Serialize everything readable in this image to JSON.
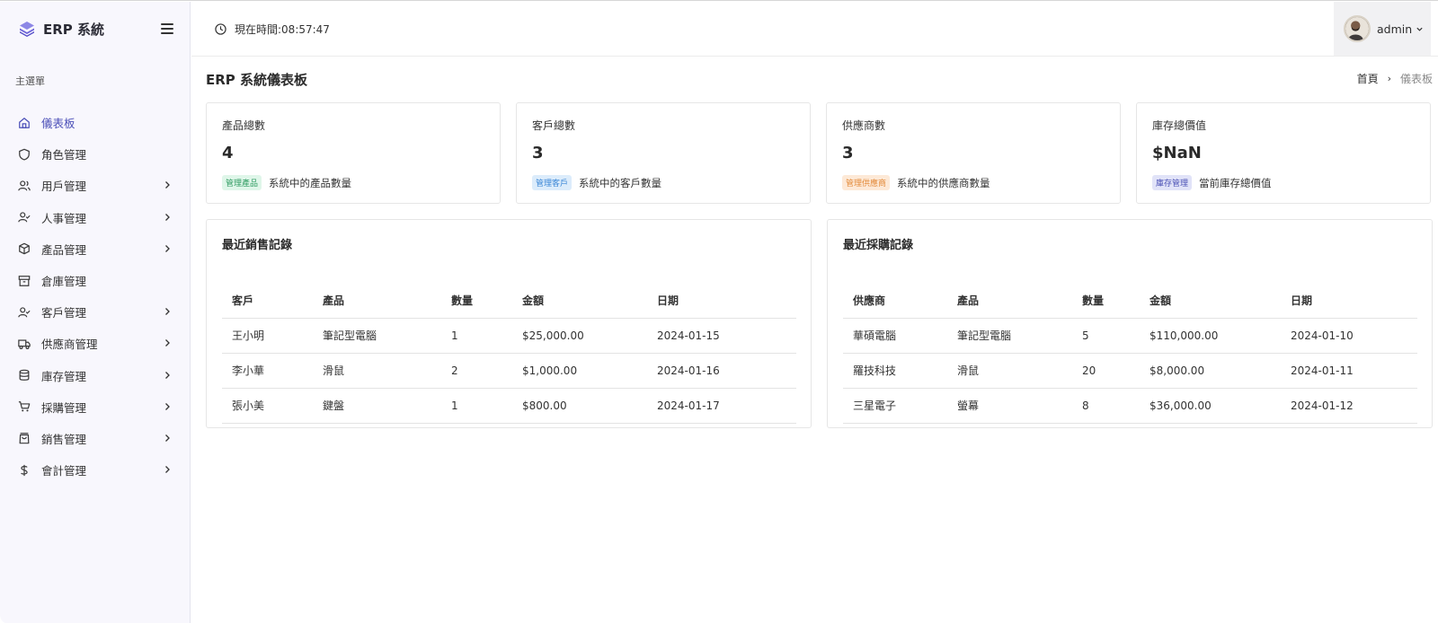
{
  "app": {
    "title": "ERP 系統"
  },
  "sidebar": {
    "section_label": "主選單",
    "items": [
      {
        "label": "儀表板",
        "icon": "home-icon",
        "active": true,
        "has_children": false
      },
      {
        "label": "角色管理",
        "icon": "shield-icon",
        "active": false,
        "has_children": false
      },
      {
        "label": "用戶管理",
        "icon": "users-icon",
        "active": false,
        "has_children": true
      },
      {
        "label": "人事管理",
        "icon": "user-check-icon",
        "active": false,
        "has_children": true
      },
      {
        "label": "產品管理",
        "icon": "package-icon",
        "active": false,
        "has_children": true
      },
      {
        "label": "倉庫管理",
        "icon": "archive-icon",
        "active": false,
        "has_children": false
      },
      {
        "label": "客戶管理",
        "icon": "user-check-icon",
        "active": false,
        "has_children": true
      },
      {
        "label": "供應商管理",
        "icon": "truck-icon",
        "active": false,
        "has_children": true
      },
      {
        "label": "庫存管理",
        "icon": "database-icon",
        "active": false,
        "has_children": true
      },
      {
        "label": "採購管理",
        "icon": "cart-icon",
        "active": false,
        "has_children": true
      },
      {
        "label": "銷售管理",
        "icon": "shopping-bag-icon",
        "active": false,
        "has_children": true
      },
      {
        "label": "會計管理",
        "icon": "dollar-icon",
        "active": false,
        "has_children": true
      }
    ]
  },
  "header": {
    "clock_text": "現在時間:08:57:47",
    "user_name": "admin"
  },
  "page": {
    "title": "ERP 系統儀表板",
    "breadcrumb": {
      "home": "首頁",
      "current": "儀表板"
    }
  },
  "stats": [
    {
      "label": "產品總數",
      "value": "4",
      "badge": "管理產品",
      "badge_color": "#2f9b61",
      "desc": "系統中的產品數量"
    },
    {
      "label": "客戶總數",
      "value": "3",
      "badge": "管理客戶",
      "badge_color": "#3a86d6",
      "desc": "系統中的客戶數量"
    },
    {
      "label": "供應商數",
      "value": "3",
      "badge": "管理供應商",
      "badge_color": "#e38a3a",
      "desc": "系統中的供應商數量"
    },
    {
      "label": "庫存總價值",
      "value": "$NaN",
      "badge": "庫存管理",
      "badge_color": "#4b51b5",
      "desc": "當前庫存總價值"
    }
  ],
  "sales": {
    "title": "最近銷售記錄",
    "columns": [
      "客戶",
      "產品",
      "數量",
      "金額",
      "日期"
    ],
    "rows": [
      [
        "王小明",
        "筆記型電腦",
        "1",
        "$25,000.00",
        "2024-01-15"
      ],
      [
        "李小華",
        "滑鼠",
        "2",
        "$1,000.00",
        "2024-01-16"
      ],
      [
        "張小美",
        "鍵盤",
        "1",
        "$800.00",
        "2024-01-17"
      ]
    ]
  },
  "purchases": {
    "title": "最近採購記錄",
    "columns": [
      "供應商",
      "產品",
      "數量",
      "金額",
      "日期"
    ],
    "rows": [
      [
        "華碩電腦",
        "筆記型電腦",
        "5",
        "$110,000.00",
        "2024-01-10"
      ],
      [
        "羅技科技",
        "滑鼠",
        "20",
        "$8,000.00",
        "2024-01-11"
      ],
      [
        "三星電子",
        "螢幕",
        "8",
        "$36,000.00",
        "2024-01-12"
      ]
    ]
  },
  "colors": {
    "accent": "#4b4fb8",
    "sidebar_bg": "#f8f7fd"
  }
}
